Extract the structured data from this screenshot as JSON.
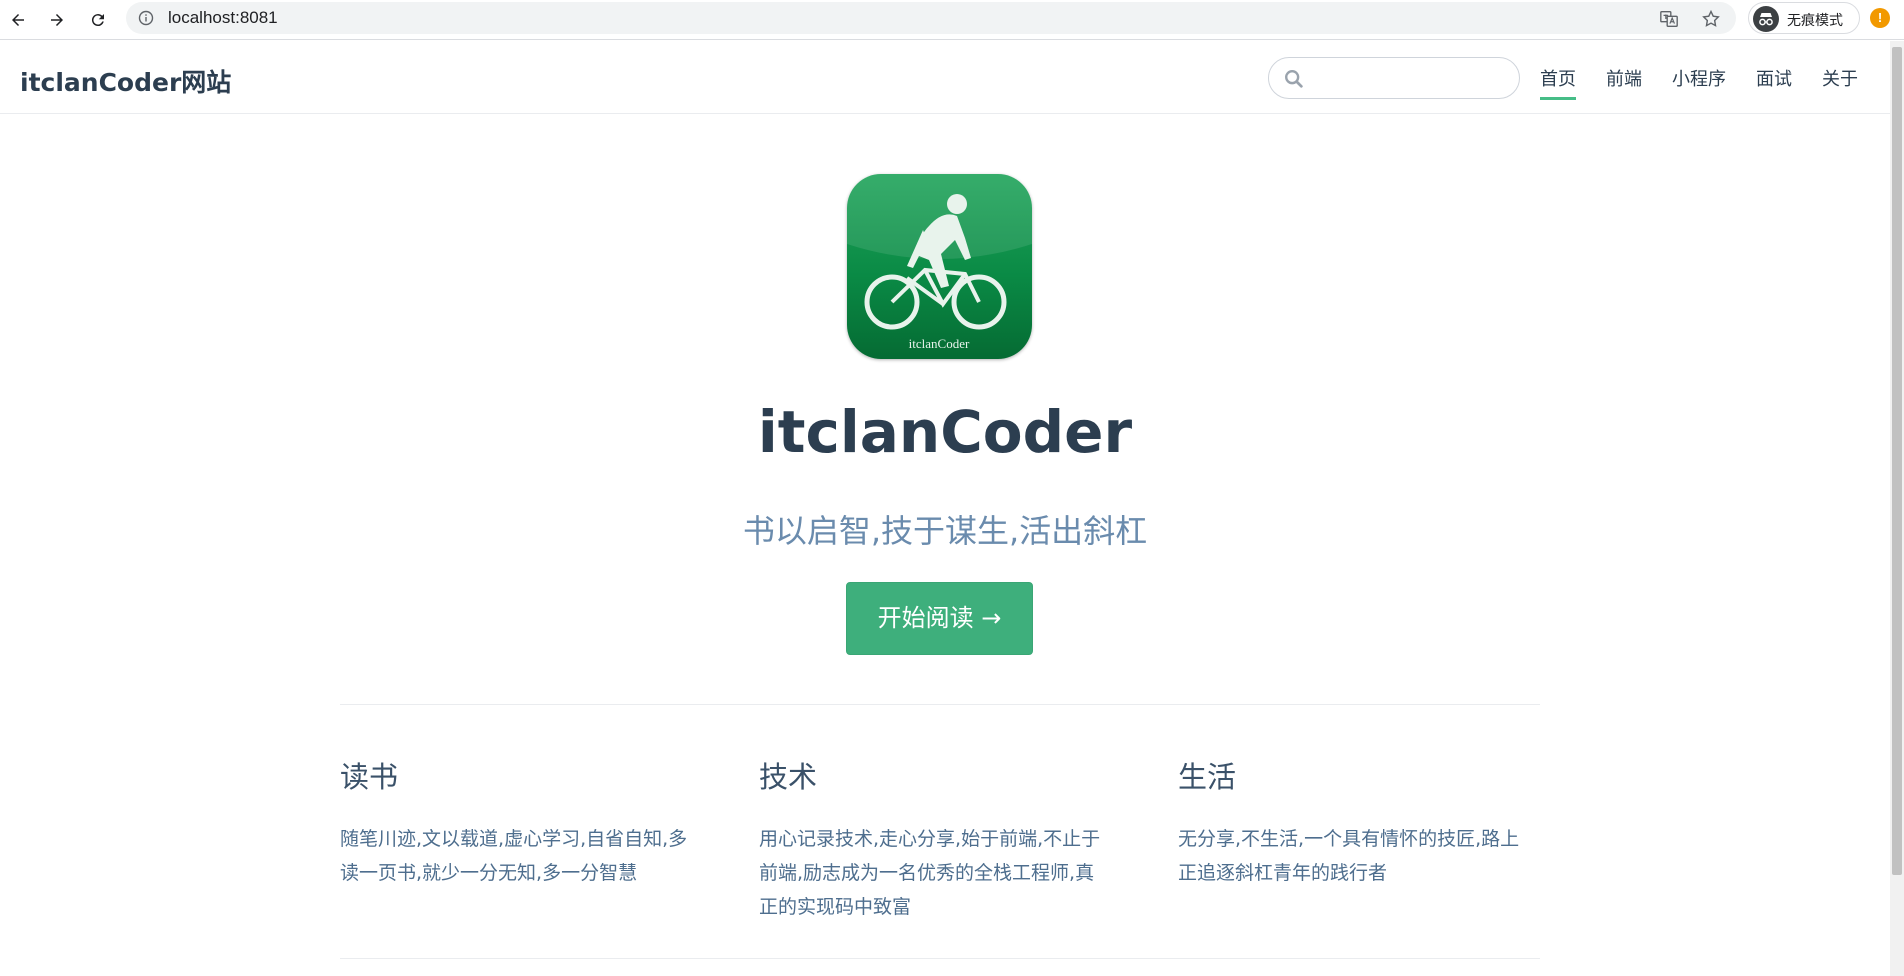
{
  "browser": {
    "url": "localhost:8081",
    "incognito_label": "无痕模式",
    "alert_badge": "!"
  },
  "navbar": {
    "site_title": "itclanCoder网站",
    "search_placeholder": "",
    "links": [
      "首页",
      "前端",
      "小程序",
      "面试",
      "关于"
    ],
    "active_link": "首页",
    "accent_color": "#46bd87"
  },
  "hero": {
    "logo_caption": "itclanCoder",
    "title": "itclanCoder",
    "tagline": "书以启智,技于谋生,活出斜杠",
    "action_label": "开始阅读 →",
    "action_color": "#3eaf7c"
  },
  "features": [
    {
      "title": "读书",
      "lines": [
        "随笔川迹,文以载道,虚心学习,自省自知,多",
        "读一页书,就少一分无知,多一分智慧"
      ]
    },
    {
      "title": "技术",
      "lines": [
        "用心记录技术,走心分享,始于前端,不止于",
        "前端,励志成为一名优秀的全栈工程师,真",
        "正的实现码中致富"
      ]
    },
    {
      "title": "生活",
      "lines": [
        "无分享,不生活,一个具有情怀的技匠,路上",
        "正追逐斜杠青年的践行者"
      ]
    }
  ]
}
